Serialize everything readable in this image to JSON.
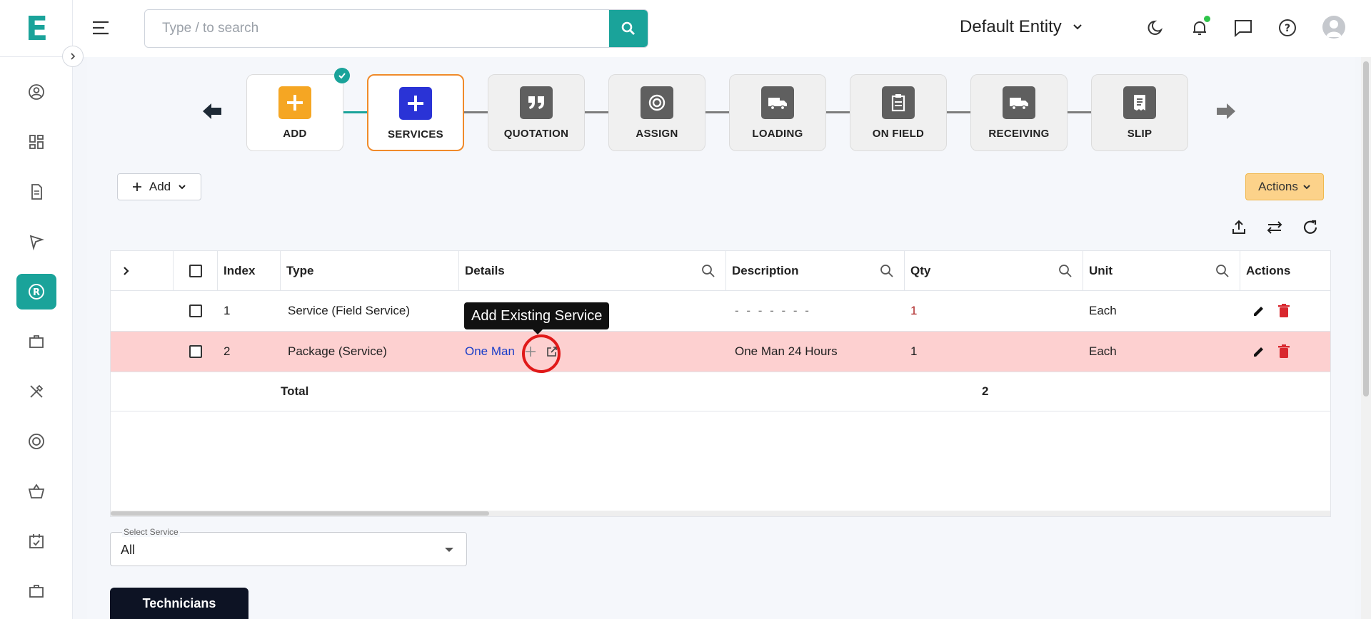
{
  "app": {
    "logo_letter": "E"
  },
  "search": {
    "placeholder": "Type / to search"
  },
  "header": {
    "entity_name": "Default Entity"
  },
  "workflow": {
    "steps": [
      {
        "label": "ADD",
        "state": "done"
      },
      {
        "label": "SERVICES",
        "state": "current"
      },
      {
        "label": "QUOTATION",
        "state": "pending"
      },
      {
        "label": "ASSIGN",
        "state": "pending"
      },
      {
        "label": "LOADING",
        "state": "pending"
      },
      {
        "label": "ON FIELD",
        "state": "pending"
      },
      {
        "label": "RECEIVING",
        "state": "pending"
      },
      {
        "label": "SLIP",
        "state": "pending"
      }
    ]
  },
  "toolbar": {
    "add_label": "Add",
    "actions_label": "Actions"
  },
  "table": {
    "columns": [
      "Index",
      "Type",
      "Details",
      "Description",
      "Qty",
      "Unit",
      "Actions"
    ],
    "rows": [
      {
        "index": "1",
        "type": "Service (Field Service)",
        "details": "",
        "description": "- - - - - - -",
        "qty": "1",
        "unit": "Each"
      },
      {
        "index": "2",
        "type": "Package (Service)",
        "details": "One Man",
        "description": "One Man 24 Hours",
        "qty": "1",
        "unit": "Each"
      }
    ],
    "total_label": "Total",
    "total_qty": "2"
  },
  "tooltip": {
    "text": "Add Existing Service"
  },
  "select_service": {
    "label": "Select Service",
    "value": "All"
  },
  "tabs": {
    "technicians_label": "Technicians"
  },
  "colors": {
    "accent": "#1aa39a",
    "current_step_border": "#f08a2a",
    "highlight_row": "#fdd0d0",
    "delete_icon": "#d9282f",
    "actions_button": "#fcd28a"
  }
}
